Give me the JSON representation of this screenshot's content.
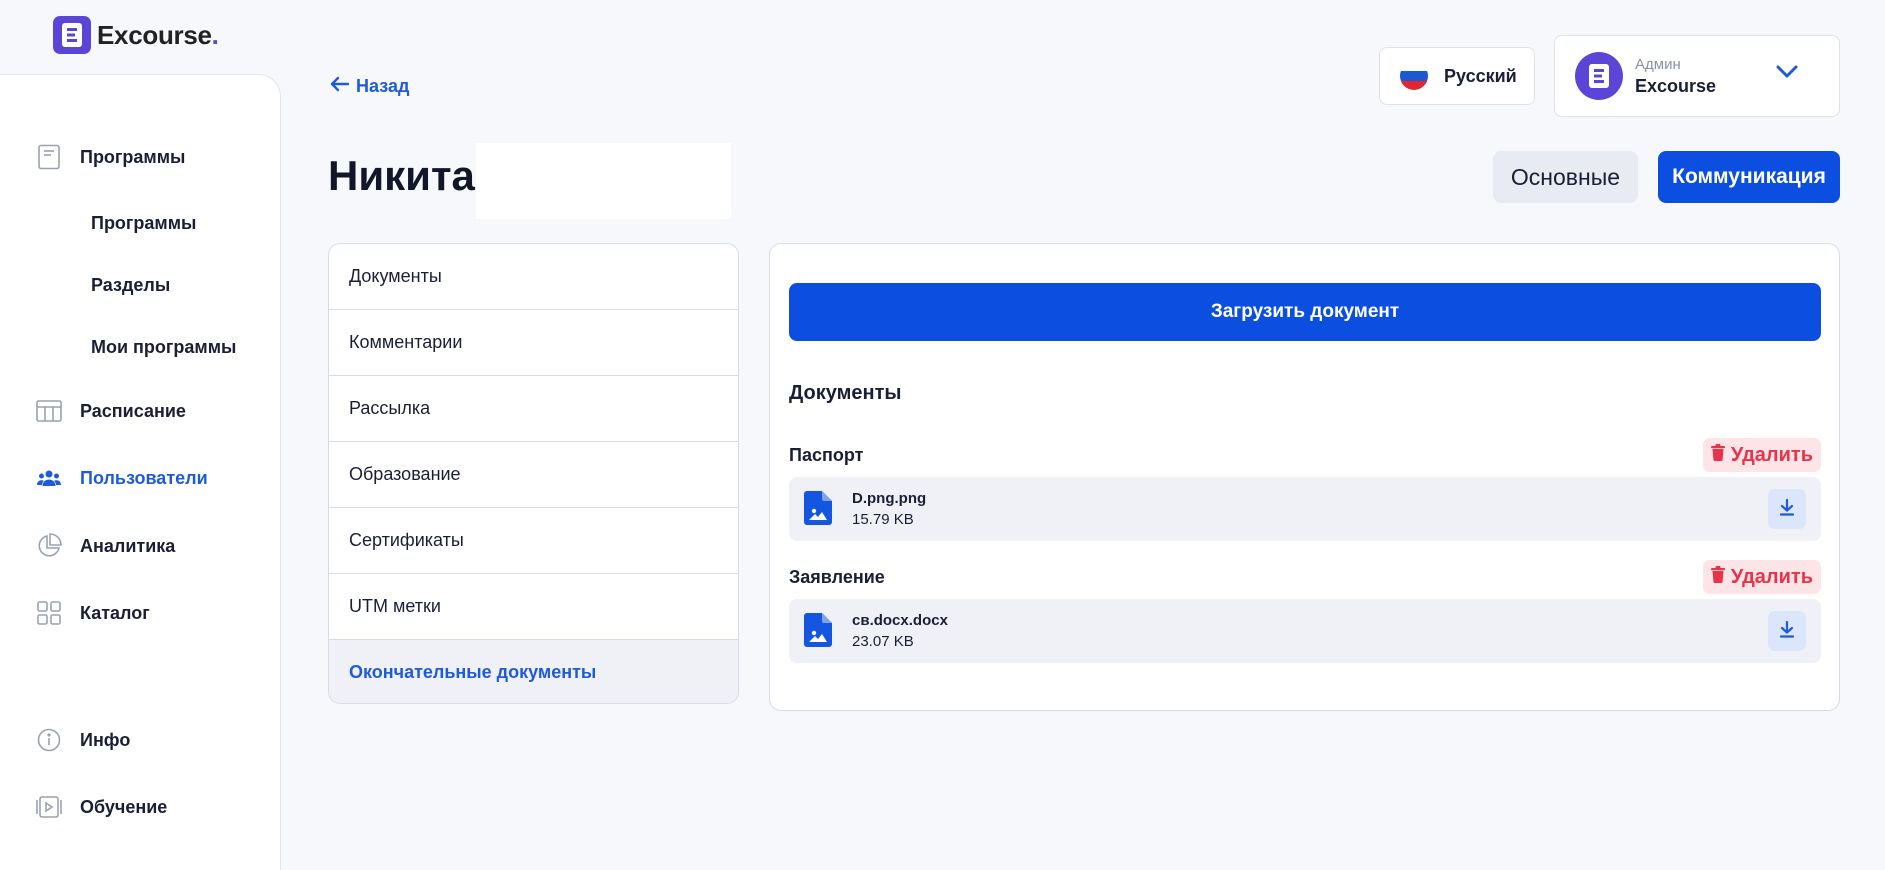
{
  "logo": {
    "text": "Excourse",
    "dot": "."
  },
  "sidebar": {
    "items": [
      {
        "label": "Программы",
        "icon": "book-icon"
      },
      {
        "label": "Программы"
      },
      {
        "label": "Разделы"
      },
      {
        "label": "Мои программы"
      },
      {
        "label": "Расписание",
        "icon": "calendar-grid-icon"
      },
      {
        "label": "Пользователи",
        "icon": "users-icon",
        "active": true
      },
      {
        "label": "Аналитика",
        "icon": "pie-chart-icon"
      },
      {
        "label": "Каталог",
        "icon": "grid-icon"
      },
      {
        "label": "Инфо",
        "icon": "info-icon"
      },
      {
        "label": "Обучение",
        "icon": "video-icon"
      }
    ]
  },
  "header": {
    "back_label": "Назад",
    "language": "Русский",
    "user": {
      "role": "Админ",
      "name": "Excourse"
    }
  },
  "page": {
    "title": "Никита",
    "tabs": {
      "main": "Основные",
      "communication": "Коммуникация"
    }
  },
  "menu": {
    "items": [
      "Документы",
      "Комментарии",
      "Рассылка",
      "Образование",
      "Сертификаты",
      "UTM метки",
      "Окончательные документы"
    ]
  },
  "documents": {
    "upload_label": "Загрузить документ",
    "heading": "Документы",
    "delete_label": "Удалить",
    "groups": [
      {
        "title": "Паспорт",
        "file_name": "D.png.png",
        "file_size": "15.79 KB"
      },
      {
        "title": "Заявление",
        "file_name": "св.docx.docx",
        "file_size": "23.07 KB"
      }
    ]
  },
  "colors": {
    "accent": "#0b4ee0",
    "brand": "#5b45d6",
    "danger": "#e8334a",
    "active_nav": "#1f5bd8"
  }
}
